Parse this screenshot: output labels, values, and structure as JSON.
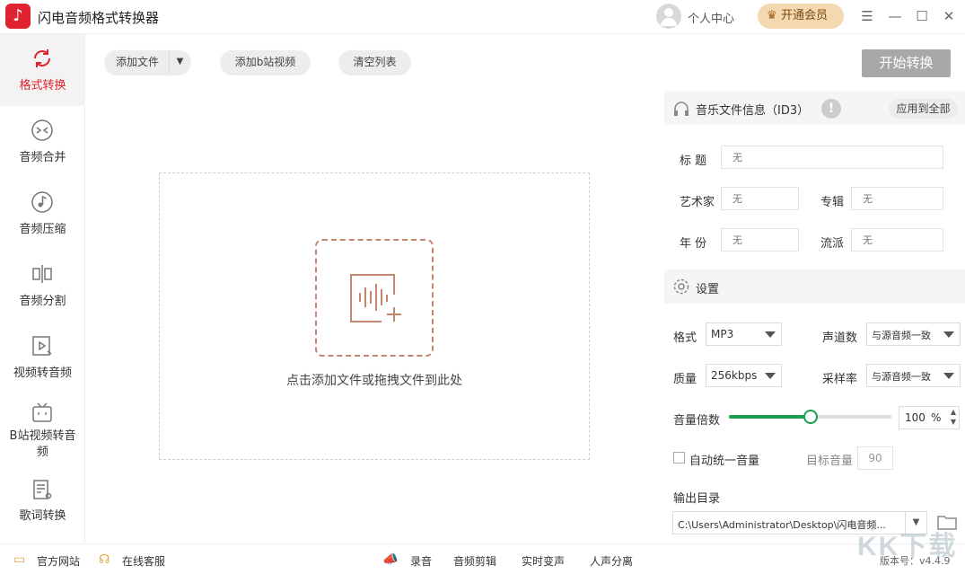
{
  "app": {
    "title": "闪电音频格式转换器",
    "logo_icon": "music-note-icon"
  },
  "header": {
    "user_center": "个人中心",
    "vip_button": "开通会员"
  },
  "sidebar": {
    "items": [
      {
        "label": "格式转换",
        "icon": "convert-icon",
        "active": true
      },
      {
        "label": "音频合并",
        "icon": "merge-icon"
      },
      {
        "label": "音频压缩",
        "icon": "compress-icon"
      },
      {
        "label": "音频分割",
        "icon": "split-icon"
      },
      {
        "label": "视频转音频",
        "icon": "video-to-audio-icon"
      },
      {
        "label": "B站视频转音频",
        "icon": "bilibili-tv-icon"
      },
      {
        "label": "歌词转换",
        "icon": "lyrics-icon"
      }
    ]
  },
  "toolbar": {
    "add_file": "添加文件",
    "add_bilibili": "添加b站视频",
    "clear_list": "清空列表",
    "start": "开始转换"
  },
  "dropzone": {
    "text": "点击添加文件或拖拽文件到此处"
  },
  "id3": {
    "section_title": "音乐文件信息（ID3）",
    "apply_all": "应用到全部",
    "title_label": "标  题",
    "artist_label": "艺术家",
    "album_label": "专辑",
    "year_label": "年  份",
    "genre_label": "流派",
    "placeholder": "无"
  },
  "settings": {
    "section_title": "设置",
    "format_label": "格式",
    "format_value": "MP3",
    "channels_label": "声道数",
    "channels_value": "与源音频一致",
    "quality_label": "质量",
    "quality_value": "256kbps",
    "samplerate_label": "采样率",
    "samplerate_value": "与源音频一致",
    "volume_label": "音量倍数",
    "volume_value": "100",
    "volume_unit": "%",
    "volume_fraction": 0.5,
    "auto_volume_label": "自动统一音量",
    "target_volume_label": "目标音量",
    "target_volume_value": "90",
    "output_dir_label": "输出目录",
    "output_dir_value": "C:\\Users\\Administrator\\Desktop\\闪电音频..."
  },
  "statusbar": {
    "website": "官方网站",
    "support": "在线客服",
    "record": "录音",
    "audio_cut": "音频剪辑",
    "voice_change": "实时变声",
    "vocal_separate": "人声分离",
    "version": "版本号：v4.4.9"
  },
  "watermark": "KK下载",
  "colors": {
    "accent": "#e0232e",
    "vip_bg": "#f3d8b0",
    "slider": "#1aa04c",
    "drop_border": "#c4866f"
  }
}
